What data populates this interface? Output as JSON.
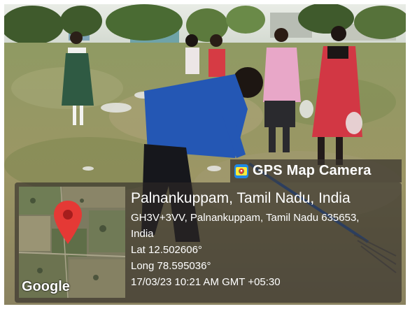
{
  "overlay": {
    "app_icon": "gps-map-camera-icon",
    "app_name": "GPS Map Camera",
    "location_title": "Palnankuppam, Tamil Nadu, India",
    "address_line1": "GH3V+3VV, Palnankuppam, Tamil Nadu 635653,",
    "address_line2": "India",
    "latitude": "Lat 12.502606°",
    "longitude": "Long 78.595036°",
    "timestamp": "17/03/23 10:21 AM GMT +05:30",
    "map_logo": "Google",
    "map_pin_icon": "map-pin-icon"
  },
  "colors": {
    "overlay_bg": "#37322d",
    "app_icon_bg": "#1e88e5",
    "map_pin": "#e53935",
    "text": "#ffffff"
  }
}
